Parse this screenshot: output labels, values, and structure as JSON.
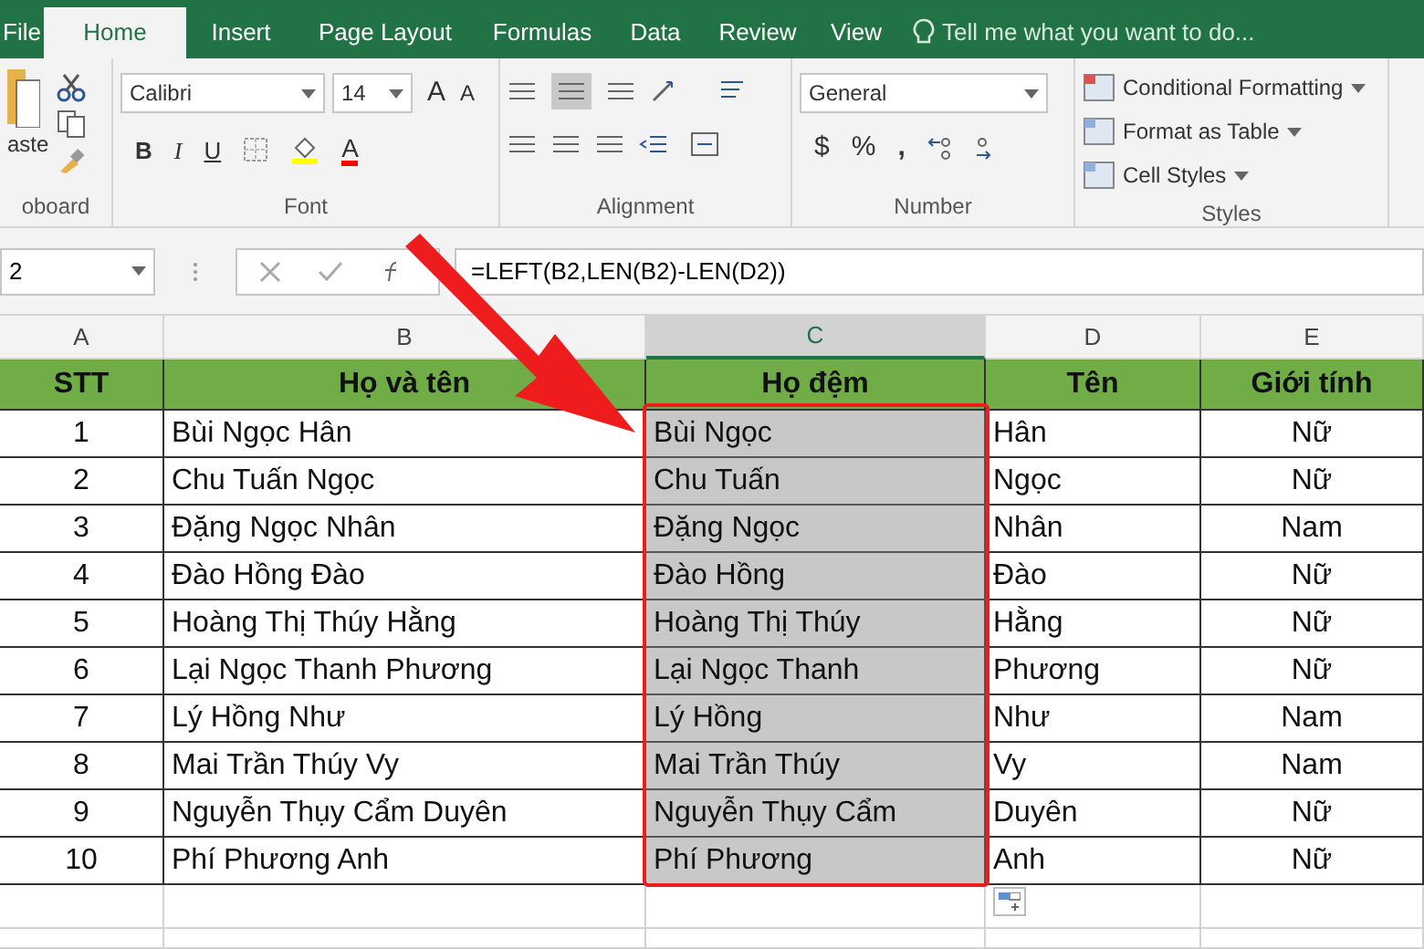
{
  "tabs": [
    {
      "label": "File",
      "selected": false
    },
    {
      "label": "Home",
      "selected": true
    },
    {
      "label": "Insert",
      "selected": false
    },
    {
      "label": "Page Layout",
      "selected": false
    },
    {
      "label": "Formulas",
      "selected": false
    },
    {
      "label": "Data",
      "selected": false
    },
    {
      "label": "Review",
      "selected": false
    },
    {
      "label": "View",
      "selected": false
    }
  ],
  "tell_me": "Tell me what you want to do...",
  "ribbon": {
    "clipboard": {
      "paste_label": "aste",
      "group_label": "oboard"
    },
    "font": {
      "font_name": "Calibri",
      "font_size": "14",
      "group_label": "Font",
      "bold": "B",
      "italic": "I",
      "underline": "U",
      "grow": "A",
      "shrink": "A",
      "font_color": "A"
    },
    "alignment": {
      "group_label": "Alignment"
    },
    "number": {
      "format": "General",
      "currency": "$",
      "percent": "%",
      "comma": ",",
      "group_label": "Number"
    },
    "styles": {
      "items": [
        "Conditional Formatting",
        "Format as Table",
        "Cell Styles"
      ],
      "group_label": "Styles"
    }
  },
  "formula_bar": {
    "name_box": "2",
    "formula": "=LEFT(B2,LEN(B2)-LEN(D2))"
  },
  "columns": [
    {
      "letter": "A",
      "selected": false
    },
    {
      "letter": "B",
      "selected": false
    },
    {
      "letter": "C",
      "selected": true
    },
    {
      "letter": "D",
      "selected": false
    },
    {
      "letter": "E",
      "selected": false
    }
  ],
  "header": [
    "STT",
    "Họ và tên",
    "Họ đệm",
    "Tên",
    "Giới tính"
  ],
  "rows": [
    [
      "1",
      "Bùi Ngọc Hân",
      "Bùi Ngọc",
      "Hân",
      "Nữ"
    ],
    [
      "2",
      "Chu Tuấn Ngọc",
      "Chu Tuấn",
      "Ngọc",
      "Nữ"
    ],
    [
      "3",
      "Đặng Ngọc Nhân",
      "Đặng Ngọc",
      "Nhân",
      "Nam"
    ],
    [
      "4",
      "Đào Hồng Đào",
      "Đào Hồng",
      "Đào",
      "Nữ"
    ],
    [
      "5",
      "Hoàng Thị Thúy Hằng",
      "Hoàng Thị Thúy",
      "Hằng",
      "Nữ"
    ],
    [
      "6",
      "Lại Ngọc Thanh Phương",
      "Lại Ngọc Thanh",
      "Phương",
      "Nữ"
    ],
    [
      "7",
      "Lý Hồng Như",
      "Lý Hồng",
      "Như",
      "Nam"
    ],
    [
      "8",
      "Mai Trần Thúy Vy",
      "Mai Trần Thúy",
      "Vy",
      "Nam"
    ],
    [
      "9",
      "Nguyễn Thụy Cẩm Duyên",
      "Nguyễn Thụy Cẩm",
      "Duyên",
      "Nữ"
    ],
    [
      "10",
      "Phí Phương Anh",
      "Phí Phương",
      "Anh",
      "Nữ"
    ]
  ]
}
